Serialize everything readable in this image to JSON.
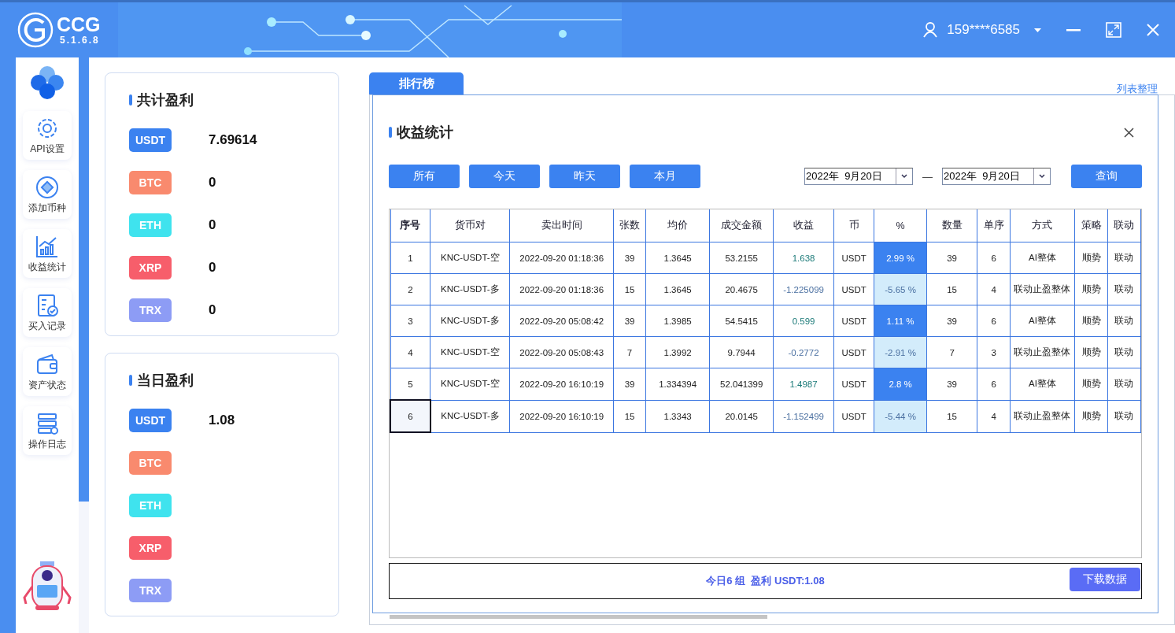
{
  "app": {
    "logo_text": "CCG",
    "version": "5.1.6.8",
    "user": "159****6585"
  },
  "sidebar": {
    "items": [
      {
        "label": "API设置"
      },
      {
        "label": "添加币种"
      },
      {
        "label": "收益统计"
      },
      {
        "label": "买入记录"
      },
      {
        "label": "资产状态"
      },
      {
        "label": "操作日志"
      }
    ]
  },
  "total_profit": {
    "title": "共计盈利",
    "coins": [
      {
        "name": "USDT",
        "color": "#3b82f0",
        "value": "7.69614"
      },
      {
        "name": "BTC",
        "color": "#f98a6e",
        "value": "0"
      },
      {
        "name": "ETH",
        "color": "#3fe3ee",
        "value": "0"
      },
      {
        "name": "XRP",
        "color": "#f75e6b",
        "value": "0"
      },
      {
        "name": "TRX",
        "color": "#8d9cf5",
        "value": "0"
      }
    ]
  },
  "daily_profit": {
    "title": "当日盈利",
    "coins": [
      {
        "name": "USDT",
        "color": "#3b82f0",
        "value": "1.08"
      },
      {
        "name": "BTC",
        "color": "#f98a6e"
      },
      {
        "name": "ETH",
        "color": "#3fe3ee"
      },
      {
        "name": "XRP",
        "color": "#f75e6b"
      },
      {
        "name": "TRX",
        "color": "#8d9cf5"
      }
    ]
  },
  "background_panel": {
    "tab": "排行榜",
    "link": "列表整理"
  },
  "dialog": {
    "title": "收益统计",
    "filters": [
      "所有",
      "今天",
      "昨天",
      "本月"
    ],
    "date_from": "2022年  9月20日",
    "date_to": "2022年  9月20日",
    "separator": "—",
    "query_button": "查询",
    "table": {
      "columns": [
        "序号",
        "货币对",
        "卖出时间",
        "张数",
        "均价",
        "成交金额",
        "收益",
        "币",
        "%",
        "数量",
        "单序",
        "方式",
        "策略",
        "联动"
      ],
      "rows": [
        {
          "kind": "gain",
          "selected": false,
          "cells": [
            "1",
            "KNC-USDT-空",
            "2022-09-20 01:18:36",
            "39",
            "1.3645",
            "53.2155",
            "1.638",
            "USDT",
            "2.99 %",
            "39",
            "6",
            "AI整体",
            "顺势",
            "联动"
          ]
        },
        {
          "kind": "loss",
          "selected": false,
          "cells": [
            "2",
            "KNC-USDT-多",
            "2022-09-20 01:18:36",
            "15",
            "1.3645",
            "20.4675",
            "-1.225099",
            "USDT",
            "-5.65 %",
            "15",
            "4",
            "联动止盈整体",
            "顺势",
            "联动"
          ]
        },
        {
          "kind": "gain",
          "selected": false,
          "cells": [
            "3",
            "KNC-USDT-多",
            "2022-09-20 05:08:42",
            "39",
            "1.3985",
            "54.5415",
            "0.599",
            "USDT",
            "1.11 %",
            "39",
            "6",
            "AI整体",
            "顺势",
            "联动"
          ]
        },
        {
          "kind": "loss",
          "selected": false,
          "cells": [
            "4",
            "KNC-USDT-空",
            "2022-09-20 05:08:43",
            "7",
            "1.3992",
            "9.7944",
            "-0.2772",
            "USDT",
            "-2.91 %",
            "7",
            "3",
            "联动止盈整体",
            "顺势",
            "联动"
          ]
        },
        {
          "kind": "gain",
          "selected": false,
          "cells": [
            "5",
            "KNC-USDT-空",
            "2022-09-20 16:10:19",
            "39",
            "1.334394",
            "52.041399",
            "1.4987",
            "USDT",
            "2.8 %",
            "39",
            "6",
            "AI整体",
            "顺势",
            "联动"
          ]
        },
        {
          "kind": "loss",
          "selected": true,
          "cells": [
            "6",
            "KNC-USDT-多",
            "2022-09-20 16:10:19",
            "15",
            "1.3343",
            "20.0145",
            "-1.152499",
            "USDT",
            "-5.44 %",
            "15",
            "4",
            "联动止盈整体",
            "顺势",
            "联动"
          ]
        }
      ]
    },
    "summary": "今日6 组  盈利 USDT:1.08",
    "download_button": "下载数据"
  }
}
